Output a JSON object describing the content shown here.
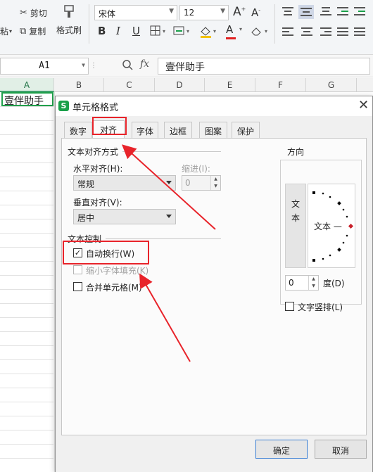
{
  "toolbar": {
    "paste_label": "粘",
    "cut_label": "剪切",
    "copy_label": "复制",
    "format_painter_label": "格式刷",
    "font_name": "宋体",
    "font_size": "12",
    "grow_font": "A",
    "shrink_font": "A",
    "bold": "B",
    "italic": "I",
    "underline": "U",
    "font_color_letter": "A"
  },
  "formula_bar": {
    "name_box": "A1",
    "fx_label": "fx",
    "content": "壹伴助手"
  },
  "sheet": {
    "columns": [
      "A",
      "B",
      "C",
      "D",
      "E",
      "F",
      "G"
    ],
    "a1_value": "壹伴助手"
  },
  "dialog": {
    "title": "单元格格式",
    "logo": "S",
    "close": "✕",
    "tabs": [
      "数字",
      "对齐",
      "字体",
      "边框",
      "图案",
      "保护"
    ],
    "active_tab": "对齐",
    "text_alignment": {
      "section_title": "文本对齐方式",
      "horizontal_label": "水平对齐(H):",
      "horizontal_value": "常规",
      "indent_label": "缩进(I):",
      "indent_value": "0",
      "vertical_label": "垂直对齐(V):",
      "vertical_value": "居中"
    },
    "text_control": {
      "section_title": "文本控制",
      "wrap_text_label": "自动换行(W)",
      "wrap_text_checked": true,
      "shrink_to_fit_label": "缩小字体填充(K)",
      "merge_cells_label": "合并单元格(M)"
    },
    "orientation": {
      "section_title": "方向",
      "vertical_text": "文本",
      "horizontal_text": "文本 —",
      "degrees_value": "0",
      "degrees_label": "度(D)",
      "vertical_stack_label": "文字竖排(L)"
    },
    "ok_label": "确定",
    "cancel_label": "取消"
  },
  "colors": {
    "annotation": "#e8232a",
    "wps_green": "#1aa04a",
    "active_cell_border": "#21a04c"
  }
}
